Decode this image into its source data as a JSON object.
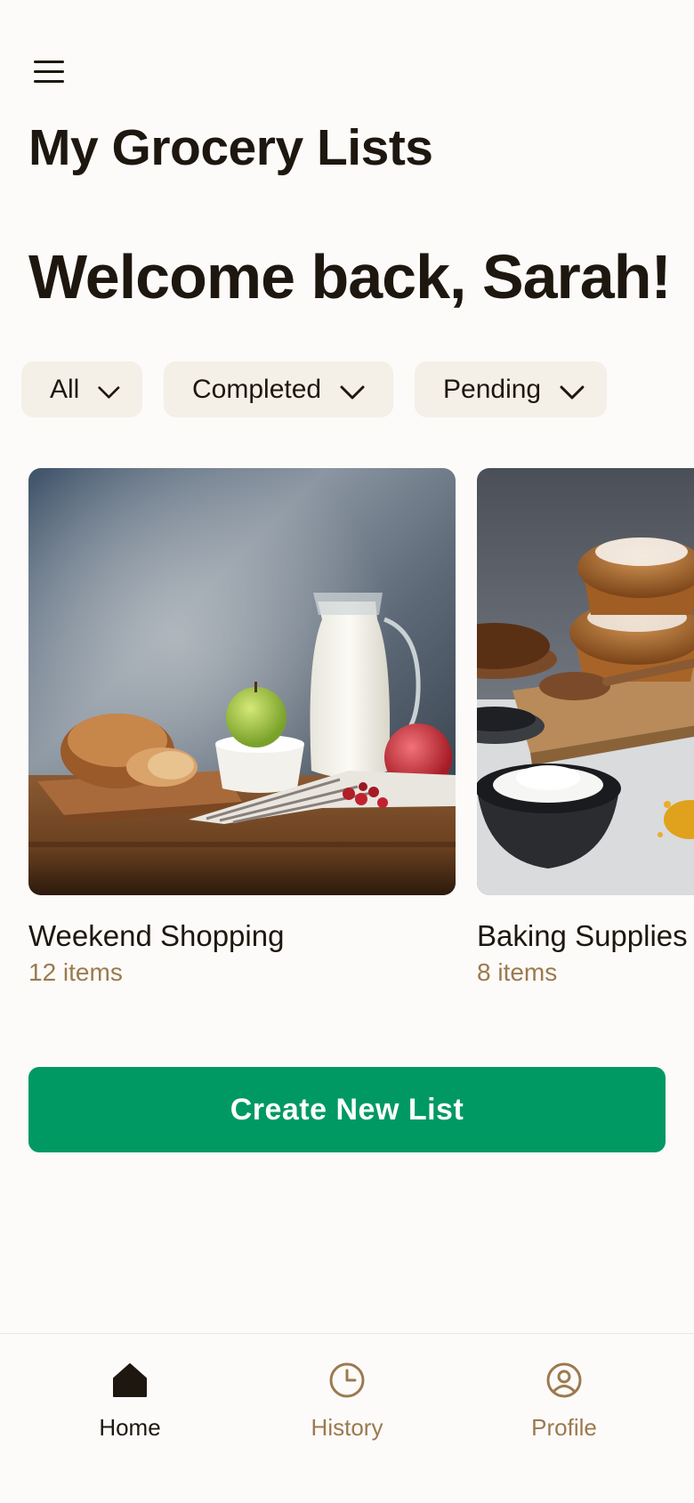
{
  "header": {
    "menu_icon": "hamburger-menu-icon",
    "title": "My Grocery Lists",
    "welcome": "Welcome back, Sarah!"
  },
  "filters": [
    {
      "label": "All",
      "icon": "chevron-down-icon"
    },
    {
      "label": "Completed",
      "icon": "chevron-down-icon"
    },
    {
      "label": "Pending",
      "icon": "chevron-down-icon"
    }
  ],
  "lists": [
    {
      "name": "Weekend Shopping",
      "count": "12 items",
      "image": "bread-milk-apples-photo"
    },
    {
      "name": "Baking Supplies",
      "count": "8 items",
      "image": "muffins-flour-spices-photo"
    }
  ],
  "actions": {
    "create_label": "Create New List"
  },
  "bottom_nav": [
    {
      "label": "Home",
      "icon": "home-icon",
      "active": true
    },
    {
      "label": "History",
      "icon": "clock-icon",
      "active": false
    },
    {
      "label": "Profile",
      "icon": "user-circle-icon",
      "active": false
    }
  ],
  "colors": {
    "background": "#fcfbf9",
    "text": "#1d170f",
    "muted": "#9b7a4e",
    "chip_bg": "#f4efe7",
    "primary": "#009963"
  }
}
